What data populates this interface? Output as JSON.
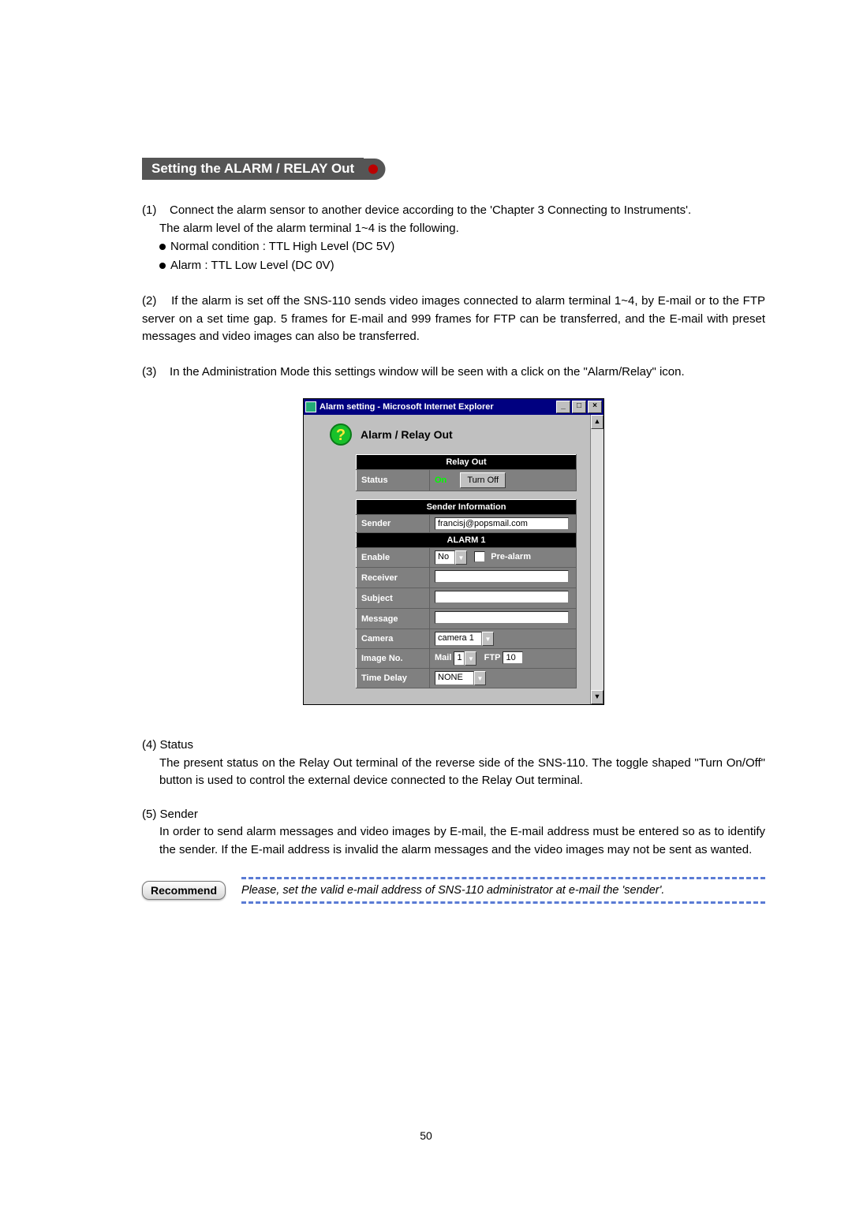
{
  "section_title": "Setting the ALARM / RELAY Out",
  "p1_num": "(1)",
  "p1_l1": "Connect the alarm sensor to another device according to the 'Chapter 3  Connecting to Instruments'.",
  "p1_l2": "The alarm  level of the alarm terminal 1~4 is the following.",
  "p1_b1": "Normal condition : TTL High Level (DC 5V)",
  "p1_b2": "Alarm : TTL Low Level (DC 0V)",
  "p2_num": "(2)",
  "p2": "If the alarm is set off the SNS-110 sends video images connected to alarm terminal 1~4, by E-mail or to the FTP server on a set time gap. 5 frames for E-mail and 999 frames for FTP can be transferred, and the E-mail with preset messages and video images can also be transferred.",
  "p3_num": "(3)",
  "p3": "In the Administration Mode this settings window will be seen with a click on the \"Alarm/Relay\" icon.",
  "win_title": "Alarm setting - Microsoft Internet Explorer",
  "panel_title": "Alarm / Relay Out",
  "relay": {
    "hdr": "Relay Out",
    "status_lbl": "Status",
    "status_val": "On",
    "toggle_btn": "Turn Off"
  },
  "sender_info": {
    "hdr": "Sender Information",
    "sender_lbl": "Sender",
    "sender_val": "francisj@popsmail.com"
  },
  "alarm1": {
    "hdr": "ALARM 1",
    "enable_lbl": "Enable",
    "enable_val": "No",
    "prealarm_lbl": "Pre-alarm",
    "receiver_lbl": "Receiver",
    "receiver_val": "",
    "subject_lbl": "Subject",
    "subject_val": "",
    "message_lbl": "Message",
    "message_val": "",
    "camera_lbl": "Camera",
    "camera_val": "camera 1",
    "imgno_lbl": "Image No.",
    "mail_lbl": "Mail",
    "mail_val": "1",
    "ftp_lbl": "FTP",
    "ftp_val": "10",
    "timedelay_lbl": "Time Delay",
    "timedelay_val": "NONE"
  },
  "p4_head": "(4)  Status",
  "p4_body": "The present status on the Relay Out terminal of the reverse side of the SNS-110. The toggle shaped \"Turn On/Off\" button is used to control the external device connected to the Relay Out terminal.",
  "p5_head": "(5)  Sender",
  "p5_body": "In order to send alarm messages and video images by E-mail, the E-mail address must be entered so as to identify the sender. If the E-mail address is invalid the alarm messages and the video images may not be sent as wanted.",
  "recommend_label": "Recommend",
  "recommend_text": "Please, set the valid e-mail address of SNS-110 administrator at  e-mail the 'sender'.",
  "page_number": "50"
}
